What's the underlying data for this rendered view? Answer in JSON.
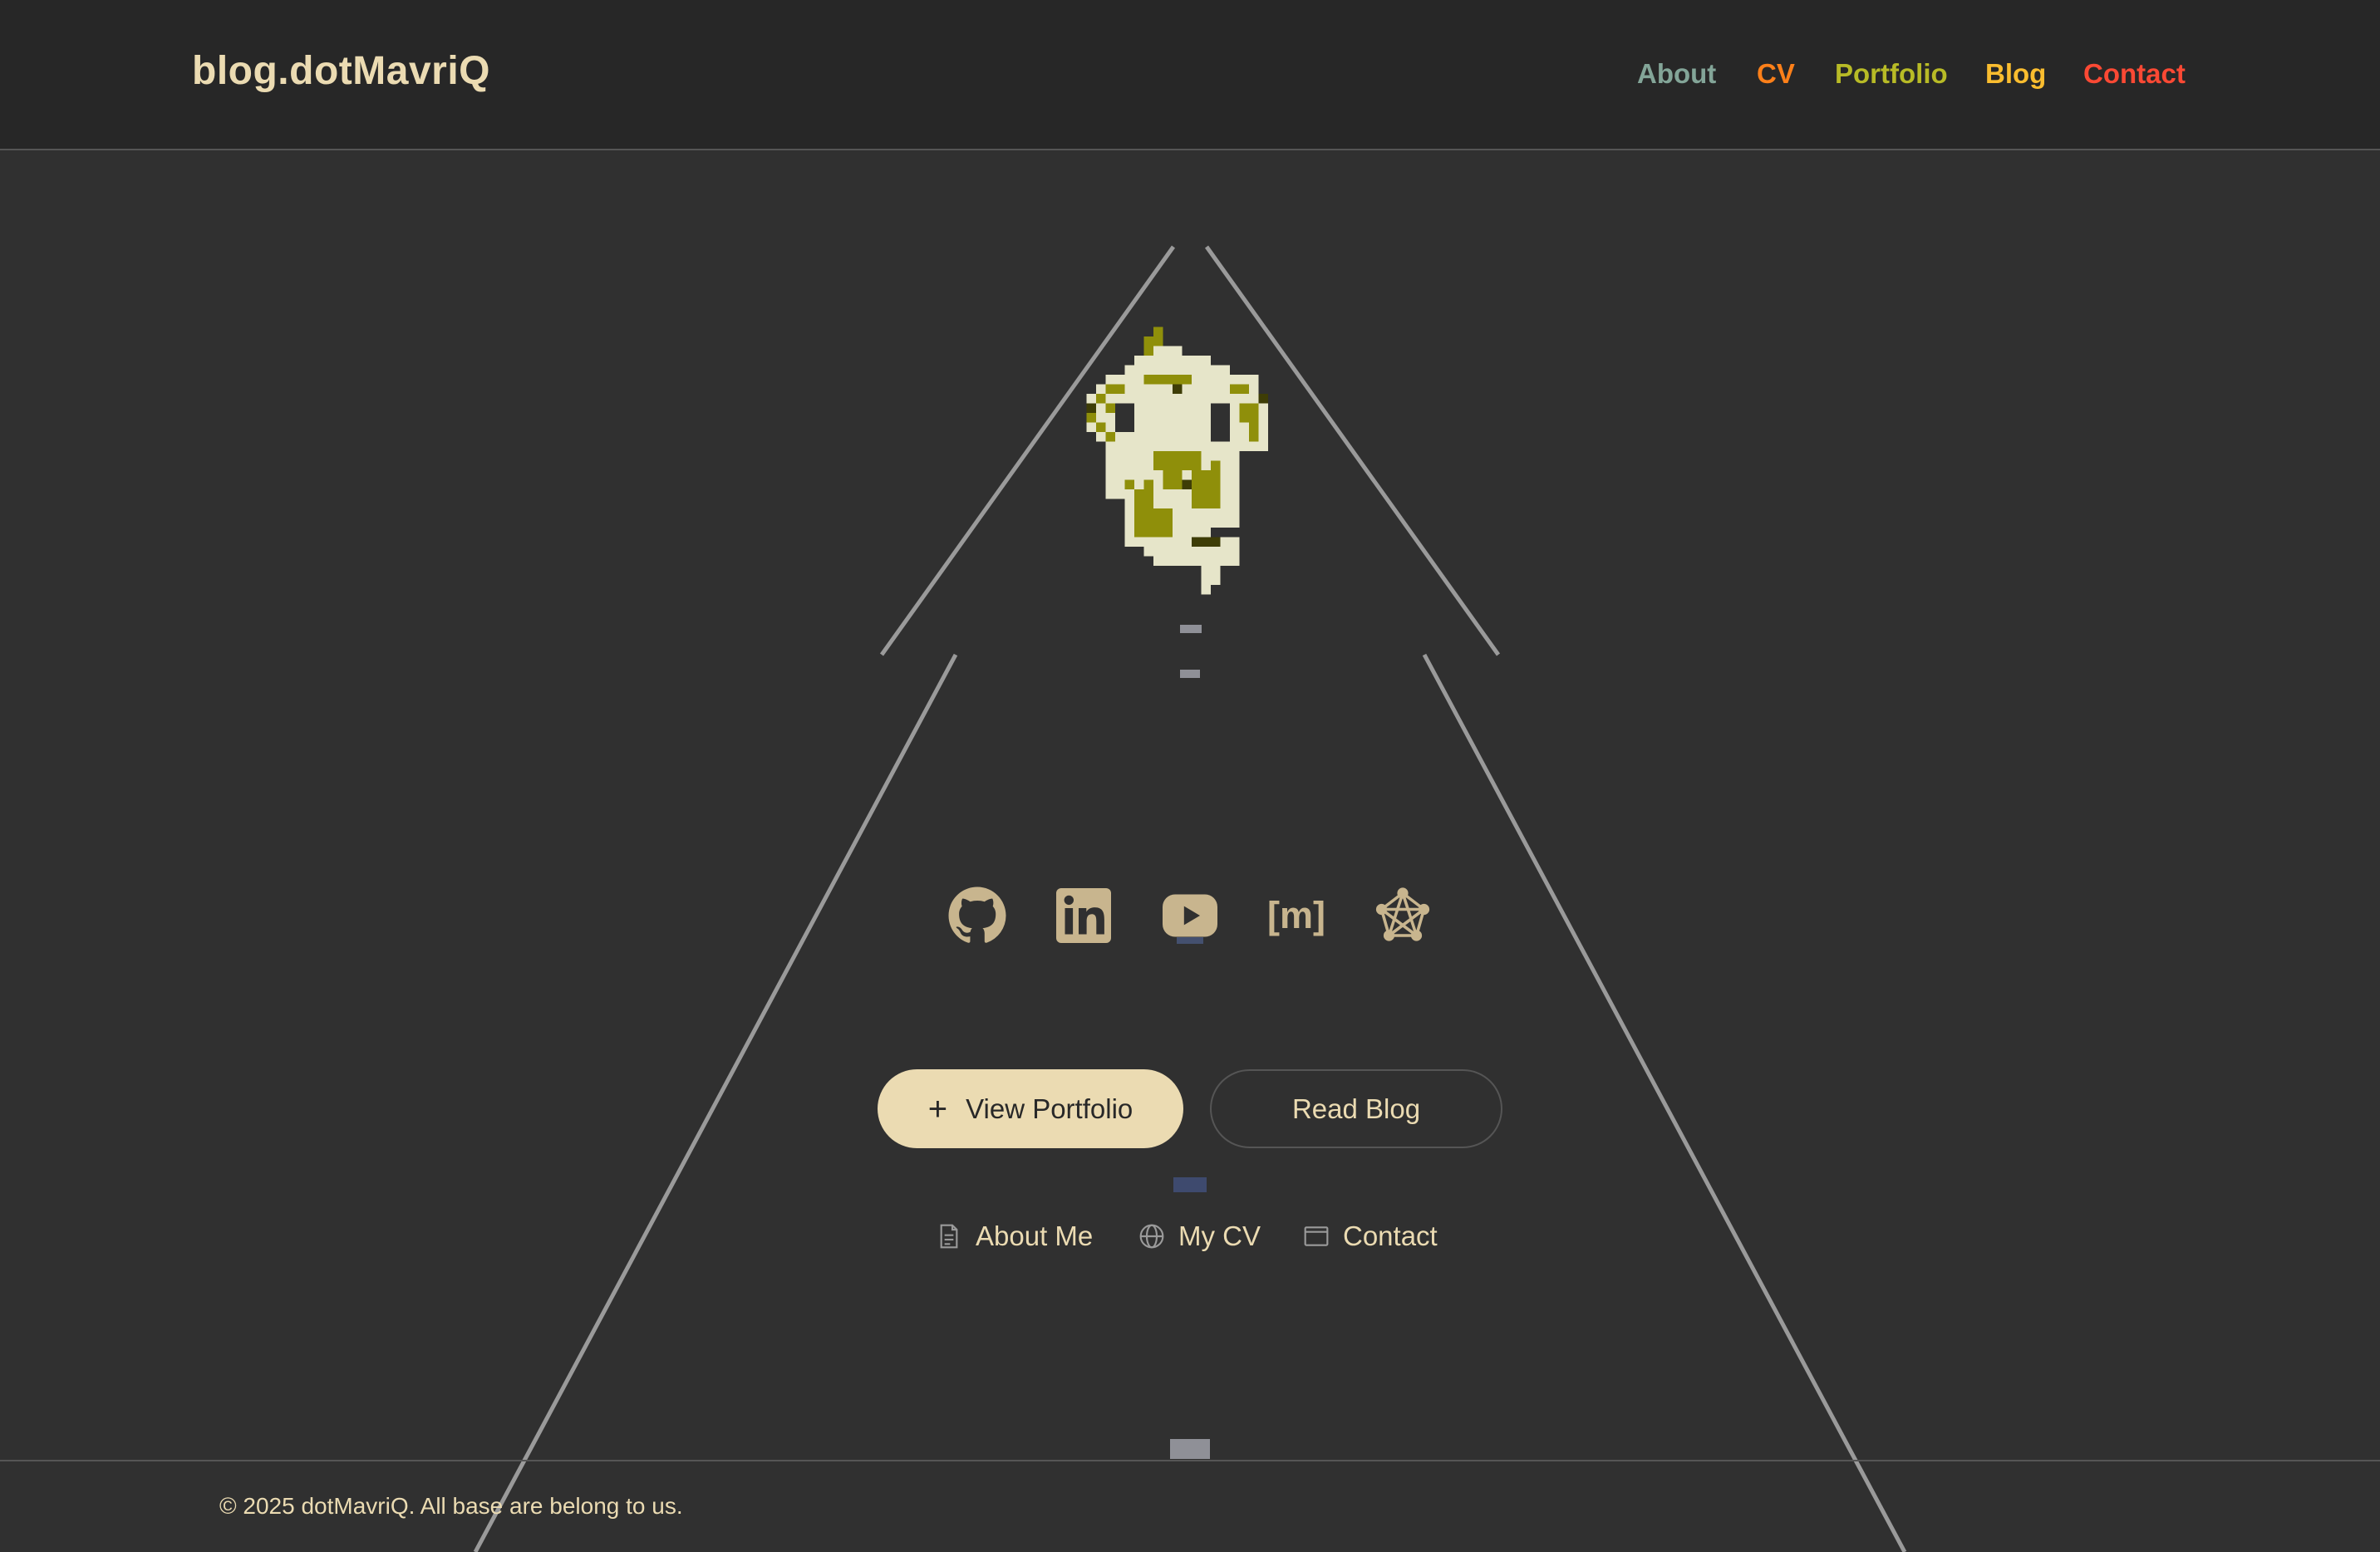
{
  "header": {
    "brand": "blog.dotMavriQ",
    "nav": [
      {
        "label": "About",
        "color": "#83a598"
      },
      {
        "label": "CV",
        "color": "#fe8019"
      },
      {
        "label": "Portfolio",
        "color": "#b8bb26"
      },
      {
        "label": "Blog",
        "color": "#fabd2f"
      },
      {
        "label": "Contact",
        "color": "#fb4934"
      }
    ]
  },
  "socials": [
    {
      "icon": "github-icon"
    },
    {
      "icon": "linkedin-icon"
    },
    {
      "icon": "youtube-icon"
    },
    {
      "icon": "matrix-icon",
      "glyph": "[m]"
    },
    {
      "icon": "fediverse-icon"
    }
  ],
  "buttons": {
    "primary": {
      "icon": "plus",
      "label": "View Portfolio"
    },
    "secondary": {
      "label": "Read Blog"
    }
  },
  "links": [
    {
      "icon": "document-icon",
      "label": "About Me"
    },
    {
      "icon": "globe-icon",
      "label": "My CV"
    },
    {
      "icon": "window-icon",
      "label": "Contact"
    }
  ],
  "footer": {
    "copyright": "© 2025 dotMavriQ. All base are belong to us."
  },
  "colors": {
    "background": "#303030",
    "header_bg": "#272727",
    "cream": "#ebdbb2",
    "icon_tan": "#c8b58e",
    "olive": "#8f8f0a",
    "dark_olive": "#3e3d06",
    "pale": "#e6e5c9"
  }
}
